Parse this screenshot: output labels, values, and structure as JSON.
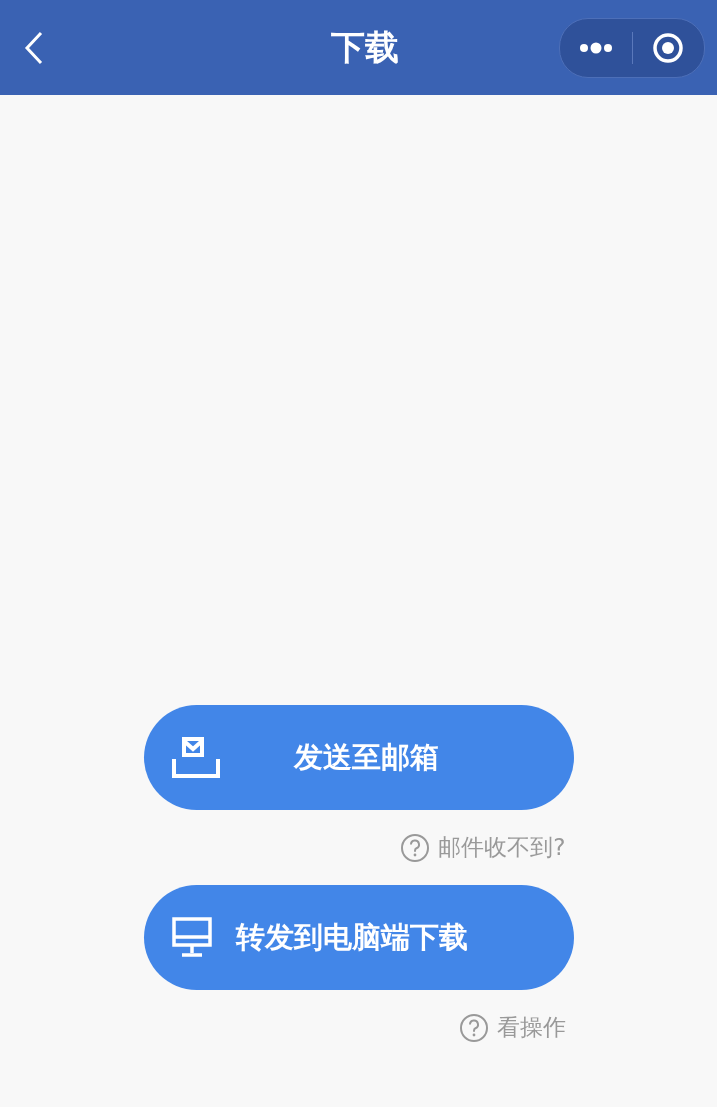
{
  "header": {
    "title": "下载"
  },
  "actions": [
    {
      "kind": "mail",
      "label": "发送至邮箱",
      "help": "邮件收不到?"
    },
    {
      "kind": "monitor",
      "label": "转发到电脑端下载",
      "help": "看操作"
    }
  ]
}
